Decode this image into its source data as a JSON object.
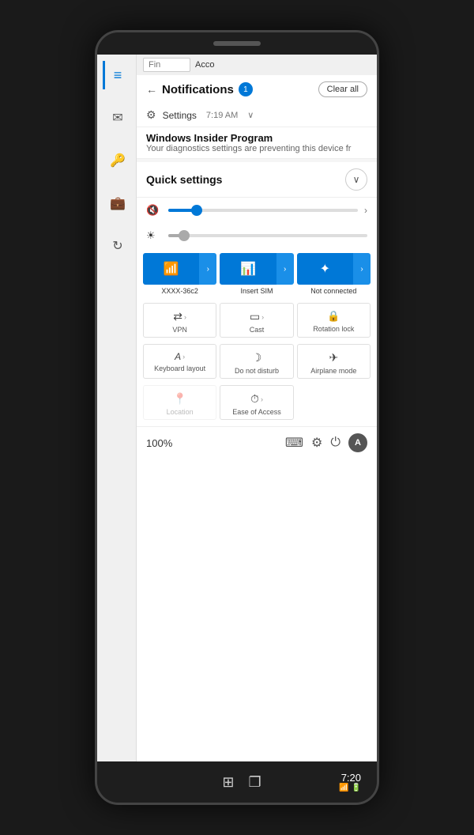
{
  "phone": {
    "top_bar": "",
    "bottom_time": "7:20",
    "bottom_status_icons": "📶🔋"
  },
  "notifications": {
    "title": "Notifications",
    "badge_count": "1",
    "clear_all_label": "Clear all",
    "back_icon": "←"
  },
  "settings_notif": {
    "icon": "⚙",
    "label": "Settings",
    "time": "7:19 AM",
    "chevron": "∨"
  },
  "insider_notif": {
    "title": "Windows Insider Program",
    "description": "Your diagnostics settings are preventing this device fr"
  },
  "quick_settings": {
    "title": "Quick settings",
    "collapse_icon": "∨",
    "volume": {
      "icon": "🔇",
      "fill_pct": 15,
      "thumb_pct": 15,
      "arrow": ">"
    },
    "brightness": {
      "icon": "☀",
      "fill_pct": 8,
      "thumb_pct": 8
    },
    "tiles_primary": [
      {
        "icon": "📶",
        "label": "XXXX-36c2",
        "has_arrow": true
      },
      {
        "icon": "📊",
        "label": "Insert SIM",
        "has_arrow": true
      },
      {
        "icon": "✦",
        "label": "Not connected",
        "has_arrow": true
      }
    ],
    "tiles_secondary": [
      {
        "icon": "⇄",
        "label": "VPN",
        "has_arrow": true
      },
      {
        "icon": "▭",
        "label": "Cast",
        "has_arrow": true
      },
      {
        "icon": "🔒",
        "label": "Rotation lock",
        "has_arrow": false
      }
    ],
    "tiles_third": [
      {
        "icon": "A",
        "label": "Keyboard layout",
        "has_arrow": true
      },
      {
        "icon": "☽",
        "label": "Do not disturb",
        "has_arrow": false
      },
      {
        "icon": "✈",
        "label": "Airplane mode",
        "has_arrow": false
      }
    ],
    "tiles_fourth": [
      {
        "icon": "📍",
        "label": "Location",
        "has_arrow": false,
        "disabled": true
      },
      {
        "icon": "⏱",
        "label": "Ease of Access",
        "has_arrow": true,
        "disabled": false
      },
      {
        "empty": true
      }
    ],
    "battery_pct": "100%",
    "bottom_icons": [
      "⌨",
      "⚙",
      "⏻"
    ],
    "avatar_label": "A"
  },
  "sidebar": {
    "items": [
      {
        "icon": "≡",
        "label": "menu",
        "active": true
      },
      {
        "icon": "✉",
        "label": "mail"
      },
      {
        "icon": "🔑",
        "label": "keys"
      },
      {
        "icon": "💼",
        "label": "briefcase"
      },
      {
        "icon": "↻",
        "label": "refresh"
      }
    ]
  },
  "top_bar": {
    "find_placeholder": "Fin",
    "acco_label": "Acco"
  },
  "taskbar": {
    "win_icon": "⊞",
    "task_icon": "❐",
    "time": "7:20"
  }
}
